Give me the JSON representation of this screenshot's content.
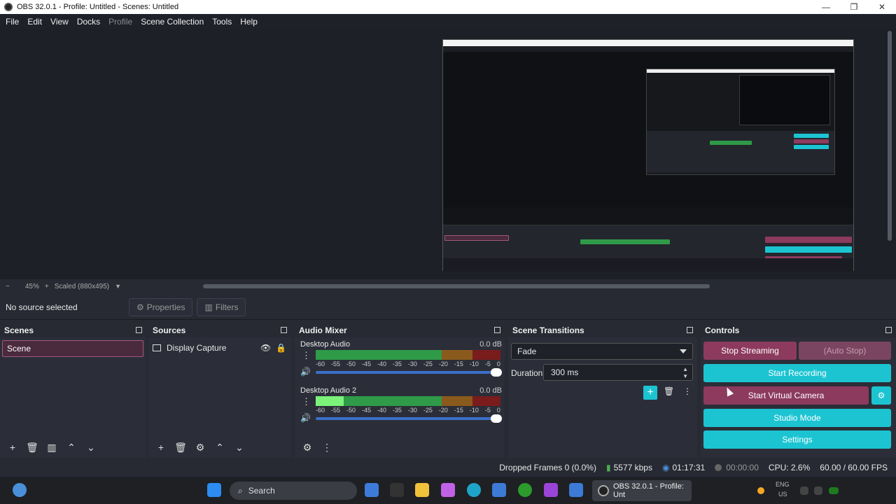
{
  "window": {
    "title": "OBS 32.0.1 - Profile: Untitled - Scenes: Untitled"
  },
  "menu": [
    "File",
    "Edit",
    "View",
    "Docks",
    "Profile",
    "Scene Collection",
    "Tools",
    "Help"
  ],
  "zoom": {
    "minus": "−",
    "percent": "45%",
    "plus": "+",
    "scale": "Scaled (880x495)"
  },
  "context": {
    "no_source": "No source selected",
    "properties": "Properties",
    "filters": "Filters"
  },
  "scenes": {
    "title": "Scenes",
    "items": [
      "Scene"
    ]
  },
  "sources": {
    "title": "Sources",
    "items": [
      "Display Capture"
    ]
  },
  "mixer": {
    "title": "Audio Mixer",
    "channels": [
      {
        "name": "Desktop Audio",
        "db": "0.0 dB",
        "level": 0.97
      },
      {
        "name": "Desktop Audio 2",
        "db": "0.0 dB",
        "level": 0.15
      }
    ],
    "ticks": [
      "-60",
      "-55",
      "-50",
      "-45",
      "-40",
      "-35",
      "-30",
      "-25",
      "-20",
      "-15",
      "-10",
      "-5",
      "0"
    ]
  },
  "transitions": {
    "title": "Scene Transitions",
    "selected": "Fade",
    "duration_label": "Duration",
    "duration": "300 ms"
  },
  "controls": {
    "title": "Controls",
    "stop_streaming": "Stop Streaming",
    "auto_stop": "(Auto Stop)",
    "start_recording": "Start Recording",
    "start_virtual_camera": "Start Virtual Camera",
    "studio_mode": "Studio Mode",
    "settings": "Settings"
  },
  "status": {
    "dropped_frames": "Dropped Frames 0 (0.0%)",
    "bitrate": "5577 kbps",
    "stream_time": "01:17:31",
    "record_time": "00:00:00",
    "cpu": "CPU: 2.6%",
    "fps": "60.00 / 60.00 FPS"
  },
  "taskbar": {
    "search": "Search",
    "obs_task": "OBS 32.0.1 - Profile: Unt",
    "lang": "ENG",
    "region": "US"
  },
  "colors": {
    "accent": "#1cc4d2",
    "stream": "#8c3a5e",
    "active_scene": "#4a2a3d"
  }
}
